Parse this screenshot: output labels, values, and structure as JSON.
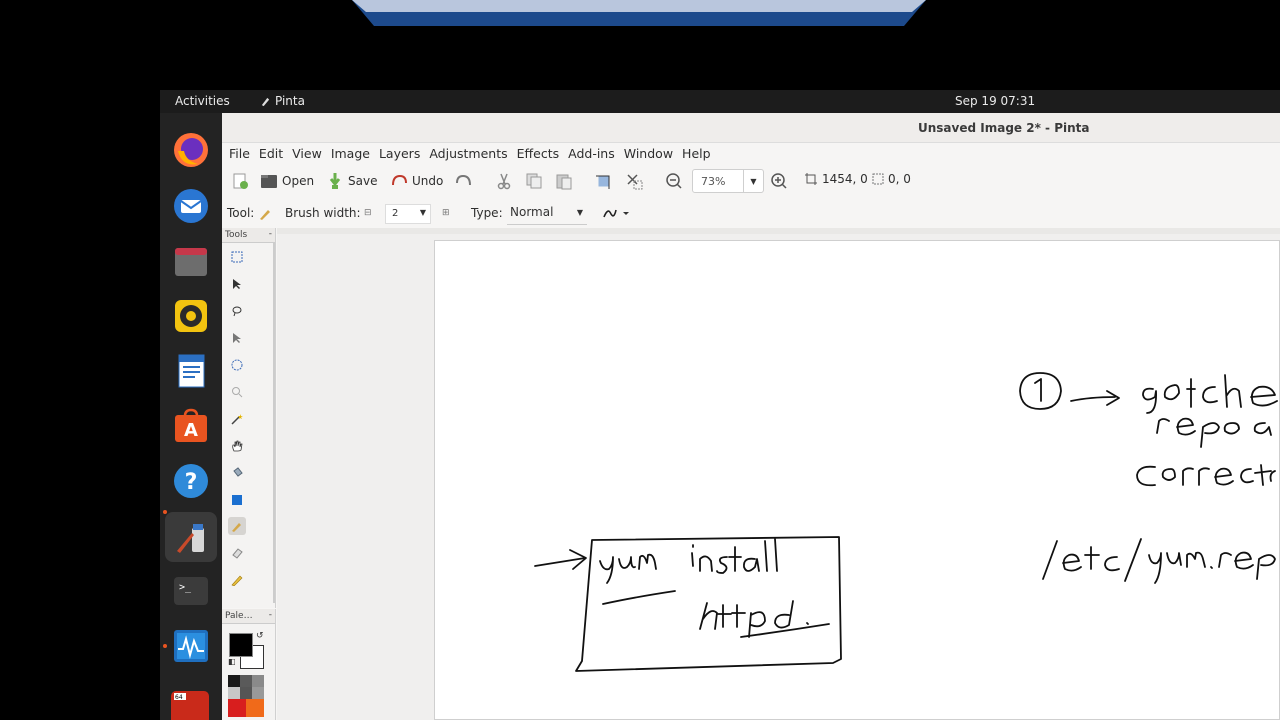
{
  "topbar": {
    "activities": "Activities",
    "app_name": "Pinta",
    "clock": "Sep 19  07:31"
  },
  "dock": {
    "items": [
      "firefox-icon",
      "thunderbird-icon",
      "files-icon",
      "rhythmbox-icon",
      "writer-icon",
      "app-center-icon",
      "help-icon",
      "pinta-icon",
      "terminal-icon",
      "system-monitor-icon",
      "apps-icon"
    ]
  },
  "window": {
    "title": "Unsaved Image 2* - Pinta"
  },
  "menu": {
    "items": [
      "File",
      "Edit",
      "View",
      "Image",
      "Layers",
      "Adjustments",
      "Effects",
      "Add-ins",
      "Window",
      "Help"
    ]
  },
  "toolbar": {
    "open": "Open",
    "save": "Save",
    "undo": "Undo",
    "zoom": "73%",
    "size": "1454, 0",
    "position": "0, 0"
  },
  "toolbar2": {
    "tool_label": "Tool:",
    "brush_width_label": "Brush width:",
    "brush_width_value": "2",
    "type_label": "Type:",
    "type_value": "Normal"
  },
  "panels": {
    "tools": "Tools",
    "palette": "Pale…"
  },
  "colors": {
    "primary": "#000000",
    "secondary": "#ffffff",
    "palette": [
      "#1a1a1a",
      "#5a5a5a",
      "#8a8a8a",
      "#c8c8c8",
      "#d81e1e",
      "#f06a1a"
    ]
  },
  "drawing": {
    "handwriting": [
      "yum install",
      "httpd.",
      "/etc/yum.repo",
      "Correcto",
      "repo ad",
      "got che"
    ]
  }
}
